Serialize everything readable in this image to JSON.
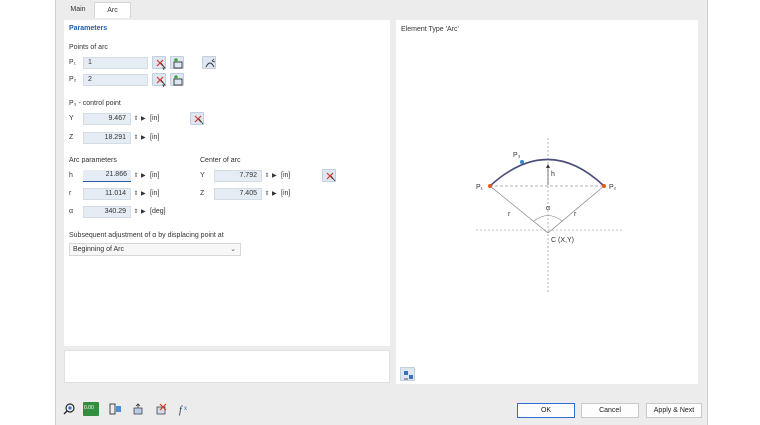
{
  "tabs": {
    "main": "Main",
    "arc": "Arc"
  },
  "parameters": {
    "title": "Parameters",
    "points_of_arc": "Points of arc",
    "p1_label": "P₁",
    "p1_value": "1",
    "p2_label": "P₂",
    "p2_value": "2",
    "control_point_title": "P₃ - control point",
    "y_label": "Y",
    "y_value": "9.467",
    "z_label": "Z",
    "z_value": "18.291",
    "unit_in": "[in]",
    "unit_deg": "[deg]"
  },
  "arc_params": {
    "title": "Arc parameters",
    "h_label": "h",
    "h_value": "21.866",
    "r_label": "r",
    "r_value": "11.014",
    "alpha_label": "α",
    "alpha_value": "340.29"
  },
  "center": {
    "title": "Center of arc",
    "y_label": "Y",
    "y_value": "7.792",
    "z_label": "Z",
    "z_value": "7.405"
  },
  "adjustment": {
    "label": "Subsequent adjustment of α by displacing point at",
    "selected": "Beginning of Arc"
  },
  "preview": {
    "title": "Element Type 'Arc'",
    "p1": "P₁",
    "p2": "P₂",
    "p3": "P₃",
    "h": "h",
    "r": "r",
    "alpha": "α",
    "center": "C (X,Y)"
  },
  "footer": {
    "ok": "OK",
    "cancel": "Cancel",
    "apply_next": "Apply & Next",
    "units_icon_text": "0.00"
  },
  "colors": {
    "accent": "#2a6fcf",
    "arc_stroke": "#4a4e7a",
    "point_end": "#e35a1a",
    "point_control": "#2a8fd0"
  }
}
